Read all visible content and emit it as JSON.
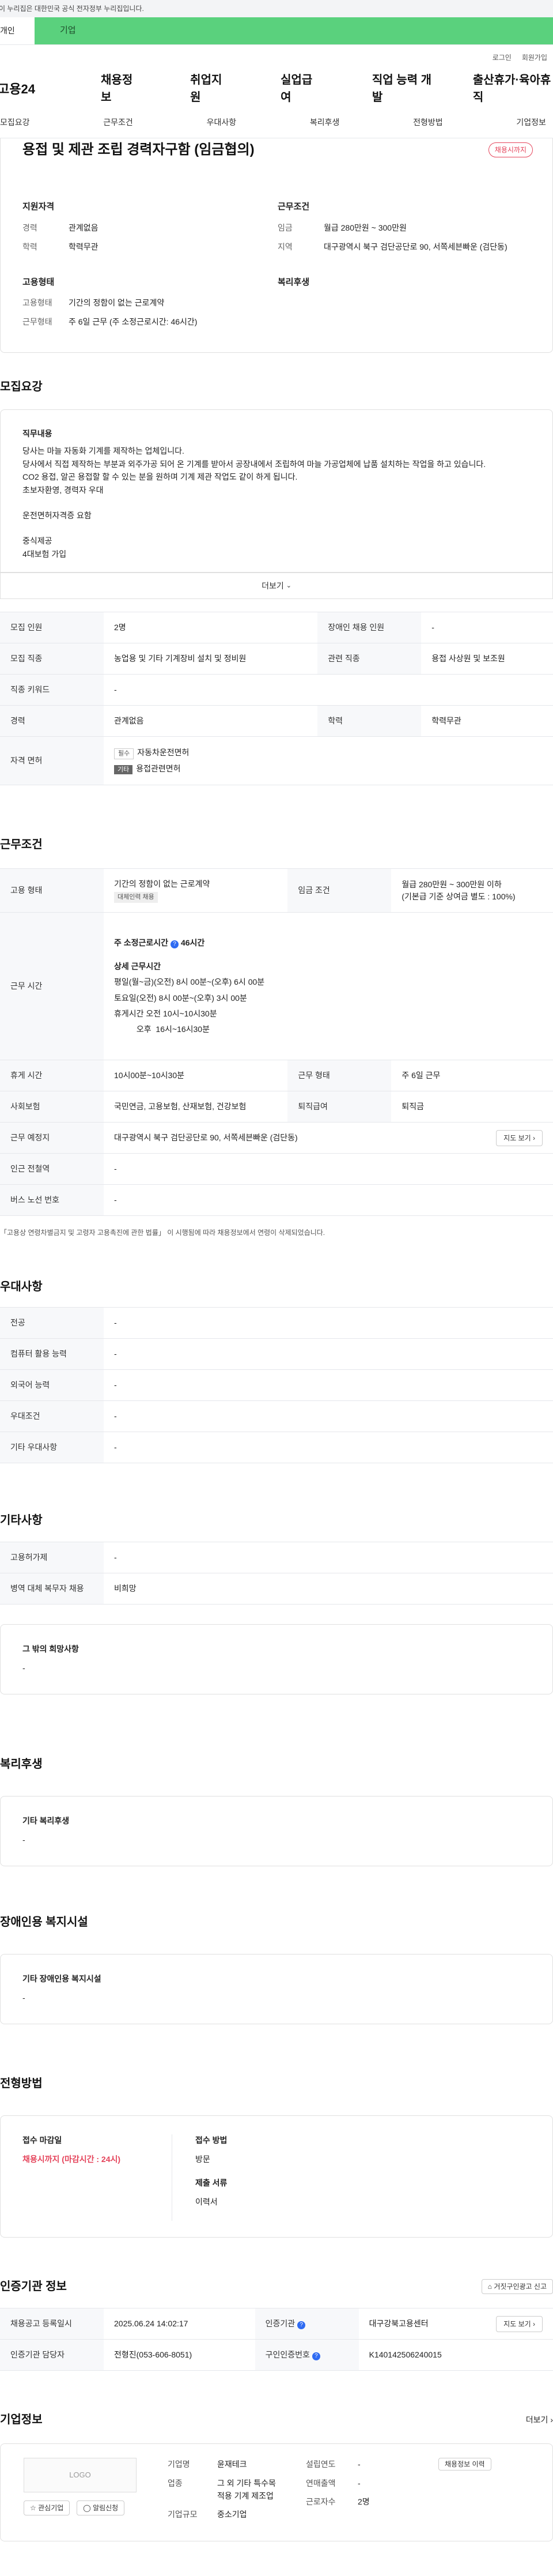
{
  "gov_notice": "이 누리집은 대한민국 공식 전자정부 누리집입니다.",
  "top_tabs": {
    "individual": "개인",
    "company": "기업"
  },
  "util": {
    "login": "로그인",
    "join": "회원가입"
  },
  "gnb": {
    "logo": "고용24",
    "items": [
      "채용정보",
      "취업지원",
      "실업급여",
      "직업 능력 개발",
      "출산휴가·육아휴직"
    ]
  },
  "subnav": [
    "모집요강",
    "근무조건",
    "우대사항",
    "복리후생",
    "전형방법",
    "기업정보"
  ],
  "job": {
    "title": "용접 및 제관 조립 경력자구함 (임금협의)",
    "status": "채용시까지",
    "qual_title": "지원자격",
    "cond_title": "근무조건",
    "career_k": "경력",
    "career_v": "관계없음",
    "edu_k": "학력",
    "edu_v": "학력무관",
    "wage_k": "임금",
    "wage_v": "월급 280만원 ~ 300만원",
    "region_k": "지역",
    "region_v": "대구광역시 북구 검단공단로 90, 서쪽세븐빠운 (검단동)",
    "emp_title": "고용형태",
    "welfare_title": "복리후생",
    "emptype_k": "고용형태",
    "emptype_v": "기간의 정함이 없는 근로계약",
    "workdays_k": "근무형태",
    "workdays_v": "주 6일 근무 (주 소정근로시간: 46시간)"
  },
  "recruit": {
    "title": "모집요강",
    "duty_title": "직무내용",
    "lines": [
      "당사는 마늘 자동화 기계를 제작하는 업체입니다.",
      "당사에서 직접 제작하는 부분과 외주가공 되어 온 기계를 받아서 공장내에서 조립하여 마늘 가공업체에 납품 설치하는 작업을 하고 있습니다.",
      "CO2 용접, 알곤 용접할 할 수 있는 분을 원하며 기계 제관 작업도 같이 하게 됩니다.",
      "초보자환영, 경력자 우대",
      "",
      "운전면허자격증 요함",
      "",
      "중식제공",
      "4대보험 가입"
    ],
    "more": "더보기",
    "rows": [
      {
        "k1": "모집 인원",
        "v1": "2명",
        "k2": "장애인 채용 인원",
        "v2": "-"
      },
      {
        "k1": "모집 직종",
        "v1": "농업용 및 기타 기계장비 설치 및 정비원",
        "k2": "관련 직종",
        "v2": "용접 사상원 및 보조원"
      },
      {
        "k1": "직종 키워드",
        "v1": "-",
        "k2": "",
        "v2": ""
      },
      {
        "k1": "경력",
        "v1": "관계없음",
        "k2": "학력",
        "v2": "학력무관"
      }
    ],
    "license_k": "자격 면허",
    "license1_badge": "필수",
    "license1": "자동차운전면허",
    "license2_badge": "기타",
    "license2": "용접관련면허"
  },
  "work": {
    "title": "근무조건",
    "emptype_k": "고용 형태",
    "emptype_v": "기간의 정함이 없는 근로계약",
    "emptype_badge": "대체인력 채용",
    "wage_k": "임금 조건",
    "wage_v1": "월급 280만원 ~ 300만원 이하",
    "wage_v2": "(기본급 기준 상여금 별도 : 100%)",
    "hours_k": "근무 시간",
    "weekly": "주 소정근로시간",
    "weekly_v": "46시간",
    "detail_title": "상세 근무시간",
    "detail_lines": [
      "평일(월~금)(오전) 8시 00분~(오후) 6시 00분",
      "토요일(오전) 8시 00분~(오후) 3시 00분",
      "휴게시간 오전 10시~10시30분",
      "          오후  16시~16시30분"
    ],
    "break_k": "휴게 시간",
    "break_v": "10시00분~10시30분",
    "form_k": "근무 형태",
    "form_v": "주 6일 근무",
    "ins_k": "사회보험",
    "ins_v": "국민연금, 고용보험, 산재보험, 건강보험",
    "sev_k": "퇴직급여",
    "sev_v": "퇴직금",
    "place_k": "근무 예정지",
    "place_v": "대구광역시 북구 검단공단로 90, 서쪽세븐빠운 (검단동)",
    "map_btn": "지도 보기",
    "subway_k": "인근 전철역",
    "subway_v": "-",
    "bus_k": "버스 노선 번호",
    "bus_v": "-",
    "notice": "「고용상 연령차별금지 및 고령자 고용촉진에 관한 법률」 이 시행됨에 따라 채용정보에서 연령이 삭제되었습니다."
  },
  "pref": {
    "title": "우대사항",
    "rows": [
      {
        "k": "전공",
        "v": "-"
      },
      {
        "k": "컴퓨터 활용 능력",
        "v": "-"
      },
      {
        "k": "외국어 능력",
        "v": "-"
      },
      {
        "k": "우대조건",
        "v": "-"
      },
      {
        "k": "기타 우대사항",
        "v": "-"
      }
    ]
  },
  "etc": {
    "title": "기타사항",
    "rows": [
      {
        "k": "고용허가제",
        "v": "-"
      },
      {
        "k": "병역 대체 복무자 채용",
        "v": "비희망"
      }
    ],
    "other_title": "그 밖의 희망사항",
    "other_v": "-"
  },
  "welfare": {
    "title": "복리후생",
    "box_title": "기타 복리후생",
    "box_v": "-"
  },
  "disabled": {
    "title": "장애인용 복지시설",
    "box_title": "기타 장애인용 복지시설",
    "box_v": "-"
  },
  "process": {
    "title": "전형방법",
    "deadline_k": "접수 마감일",
    "deadline_v": "채용시까지 (마감시간 : 24시)",
    "method_k": "접수 방법",
    "method_v": "방문",
    "docs_k": "제출 서류",
    "docs_v": "이력서"
  },
  "cert": {
    "title": "인증기관 정보",
    "report_btn": "거짓구인광고 신고",
    "date_k": "채용공고 등록일시",
    "date_v": "2025.06.24 14:02:17",
    "org_k": "인증기관",
    "org_v": "대구강북고용센터",
    "map_btn": "지도 보기",
    "mgr_k": "인증기관 담당자",
    "mgr_v": "전형진(053-606-8051)",
    "no_k": "구인인증번호",
    "no_v": "K140142506240015"
  },
  "company": {
    "title": "기업정보",
    "more": "더보기",
    "logo": "LOGO",
    "fav_btn": "관심기업",
    "alarm_btn": "알림신청",
    "name_k": "기업명",
    "name_v": "윤재테크",
    "ind_k": "업종",
    "ind_v1": "그 외 기타 특수목",
    "ind_v2": "적용 기계 제조업",
    "size_k": "기업규모",
    "size_v": "중소기업",
    "year_k": "설립연도",
    "year_v": "-",
    "rev_k": "연매출액",
    "rev_v": "-",
    "emp_k": "근로자수",
    "emp_v": "2명",
    "history_btn": "채용정보 이력"
  }
}
